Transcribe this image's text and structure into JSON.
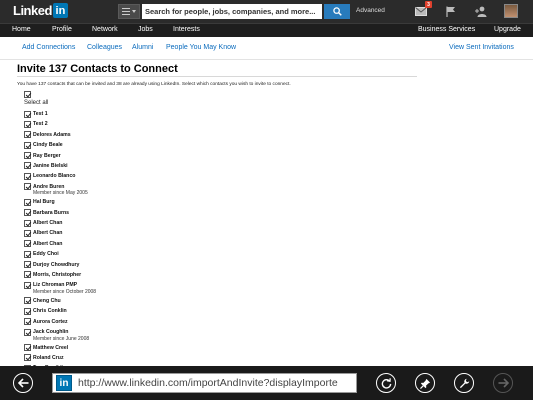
{
  "header": {
    "logo_text": "Linked",
    "logo_box": "in",
    "search_placeholder": "Search for people, jobs, companies, and more...",
    "advanced_label": "Advanced",
    "notification_count": "3"
  },
  "nav": {
    "items": [
      {
        "label": "Home"
      },
      {
        "label": "Profile"
      },
      {
        "label": "Network"
      },
      {
        "label": "Jobs"
      },
      {
        "label": "Interests"
      }
    ],
    "business_services": "Business Services",
    "upgrade": "Upgrade"
  },
  "subnav": {
    "links": [
      {
        "label": "Add Connections"
      },
      {
        "label": "Colleagues"
      },
      {
        "label": "Alumni"
      },
      {
        "label": "People You May Know"
      }
    ],
    "view_sent": "View Sent Invitations"
  },
  "page": {
    "title": "Invite 137 Contacts to Connect",
    "intro": "You have 137 contacts that can be invited and 38 are already using LinkedIn. Select which contacts you wish to invite to connect.",
    "select_all": "Select all"
  },
  "contacts": [
    {
      "name": "Test 1"
    },
    {
      "name": "Test 2"
    },
    {
      "name": "Delores Adams"
    },
    {
      "name": "Cindy Beale"
    },
    {
      "name": "Ray Berger"
    },
    {
      "name": "Janine Bielski"
    },
    {
      "name": "Leonardo Blanco"
    },
    {
      "name": "Andre Buren",
      "member_since": "Member since May 2005"
    },
    {
      "name": "Hal Burg"
    },
    {
      "name": "Barbara Burns"
    },
    {
      "name": "Albert Chan"
    },
    {
      "name": "Albert Chan"
    },
    {
      "name": "Albert Chan"
    },
    {
      "name": "Eddy Choi"
    },
    {
      "name": "Durjoy Chowdhury"
    },
    {
      "name": "Morris, Christopher"
    },
    {
      "name": "Liz Chroman PMP",
      "member_since": "Member since October 2008"
    },
    {
      "name": "Cheng Chu"
    },
    {
      "name": "Chris Conklin"
    },
    {
      "name": "Aurora Cortez"
    },
    {
      "name": "Jack Coughlin",
      "member_since": "Member since June 2008"
    },
    {
      "name": "Matthew Creel"
    },
    {
      "name": "Roland Cruz"
    },
    {
      "name": "Tom Dewildt"
    }
  ],
  "browser": {
    "url": "http://www.linkedin.com/importAndInvite?displayImporte",
    "favicon": "in"
  },
  "colors": {
    "topbar": "#2b2b2b",
    "navbar": "#1e1e1e",
    "link": "#0a6bbd",
    "search_button": "#287bbc",
    "brand": "#0077b5",
    "bottombar": "#1a1a1a"
  }
}
